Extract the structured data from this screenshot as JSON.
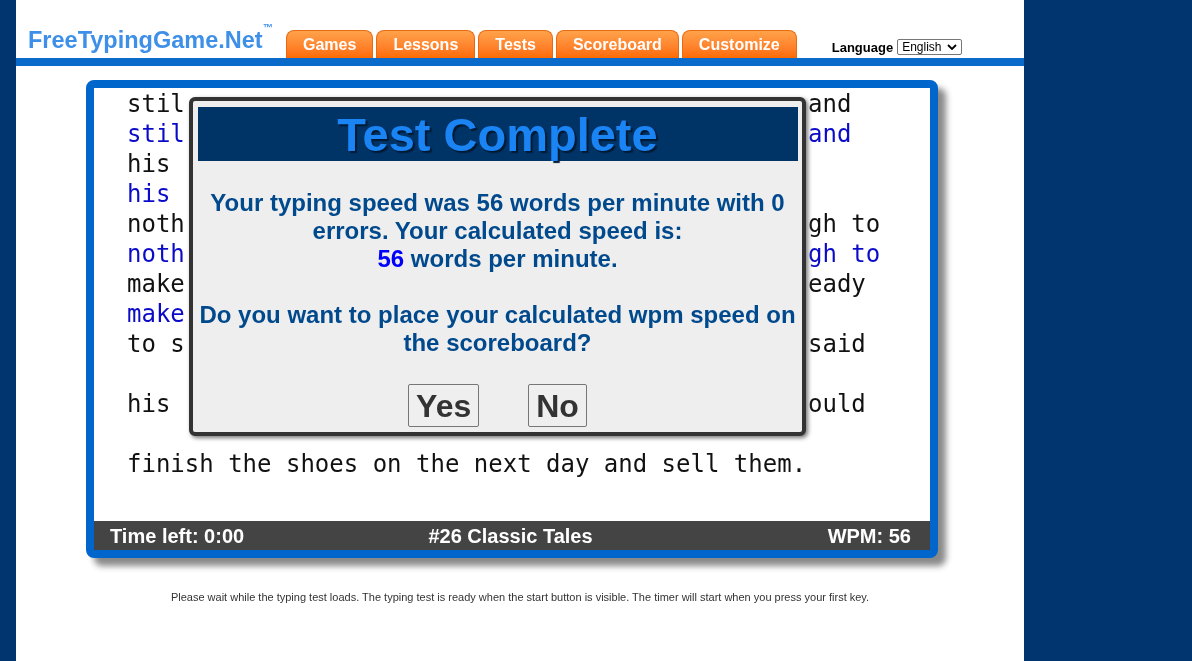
{
  "logo": "FreeTypingGame.Net$^{™}$",
  "nav_tabs": [
    "Games",
    "Lessons",
    "Tests",
    "Scoreboard",
    "Customize"
  ],
  "language": {
    "label": "Language",
    "value": "English"
  },
  "test": {
    "passage": [
      {
        "source": {
          "left": "stil",
          "right": "and"
        },
        "typed": {
          "left": "stil",
          "right": "and"
        }
      },
      {
        "source": {
          "left": "his"
        },
        "typed": {
          "left": "his"
        }
      },
      {
        "source": {
          "left": "noth",
          "right": "gh to"
        },
        "typed": {
          "left": "noth",
          "right": "gh to"
        }
      },
      {
        "source": {
          "left": "make",
          "right": "eady"
        },
        "typed": {
          "left": "make"
        }
      },
      {
        "source": {
          "left": "to s",
          "right": "said"
        }
      },
      {
        "source": {
          "left": "his",
          "right": "ould"
        }
      },
      {
        "source": {
          "left": "finish the shoes on the next day and sell them."
        }
      }
    ],
    "status_bar": {
      "time_left": "Time left: 0:00",
      "title": "#26 Classic Tales",
      "wpm": "WPM: 56"
    }
  },
  "dialog": {
    "title": "Test Complete",
    "result": "Your typing speed was 56 words per minute with 0 errors. Your calculated speed is:",
    "calculated_speed": "56",
    "calculated_unit": "words per minute.",
    "question": "Do you want to place your calculated wpm speed on the scoreboard?",
    "buttons": [
      "Yes",
      "No"
    ]
  },
  "footer_note": "Please wait while the typing test loads. The typing test is ready when the start button is visible. The timer will start when you press your first key."
}
